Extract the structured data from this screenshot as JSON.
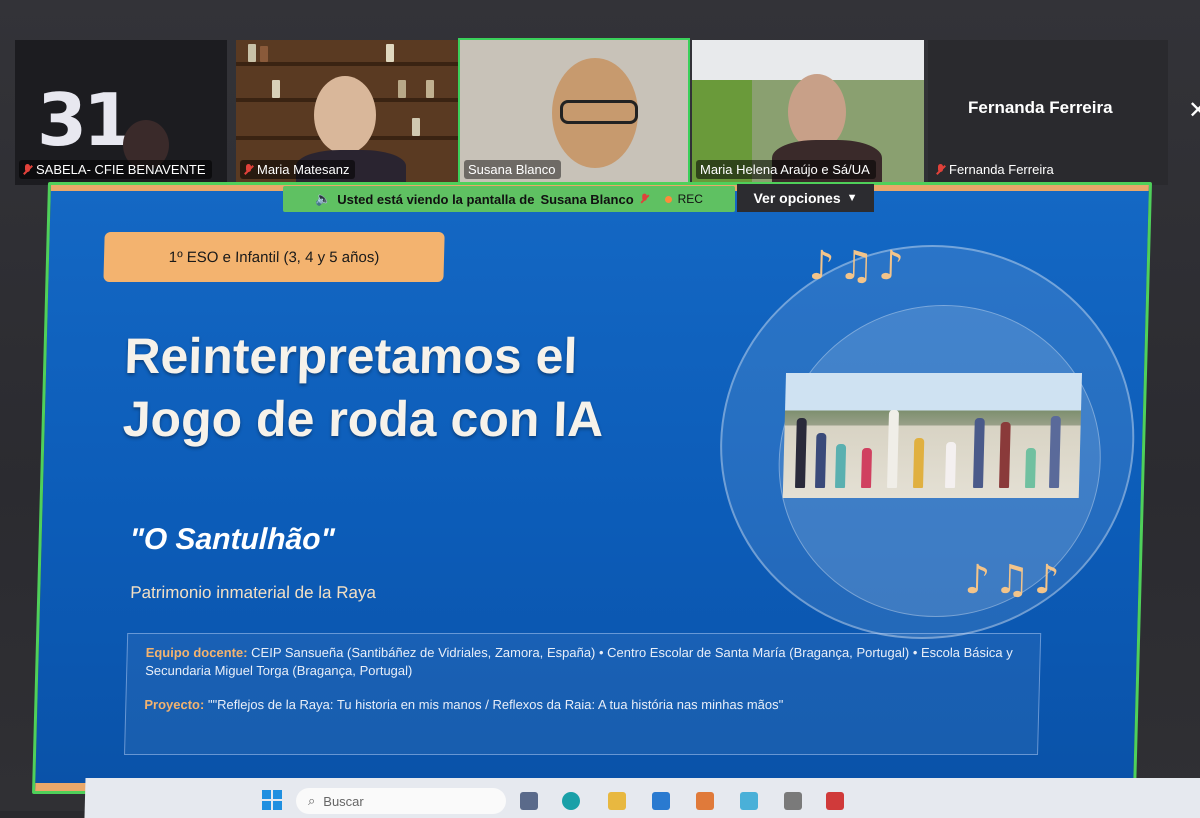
{
  "participants": [
    {
      "name": "SABELA- CFIE BENAVENTE",
      "muted": true,
      "overlay_text": "31"
    },
    {
      "name": "Maria Matesanz",
      "muted": true
    },
    {
      "name": "Susana Blanco",
      "muted": false,
      "active_speaker": true
    },
    {
      "name": "Maria Helena Araújo e Sá/UA",
      "muted": true
    },
    {
      "name": "Fernanda Ferreira",
      "muted": true,
      "title": "Fernanda Ferreira"
    }
  ],
  "share_banner": {
    "text_prefix": "Usted está viendo la pantalla de",
    "presenter": "Susana Blanco",
    "rec_label": "REC",
    "options_label": "Ver opciones"
  },
  "slide": {
    "tag": "1º ESO e Infantil (3, 4 y 5 años)",
    "title_line1": "Reinterpretamos el",
    "title_line2": "Jogo de roda con IA",
    "subtitle": "\"O Santulhão\"",
    "tagline": "Patrimonio inmaterial de la Raya",
    "notes_top": "♪♫♪",
    "notes_bottom": "♪♫♪",
    "team_label": "Equipo docente:",
    "team_text": "CEIP Sansueña (Santibáñez de Vidriales, Zamora, España)  •  Centro Escolar de Santa María (Bragança, Portugal)  •  Escola Básica y Secundaria Miguel Torga (Bragança, Portugal)",
    "project_label": "Proyecto:",
    "project_text": "\"\"Reflejos de la Raya: Tu historia en mis manos / Reflexos da Raia: A tua história nas minhas mãos\""
  },
  "taskbar": {
    "search_placeholder": "Buscar"
  },
  "colors": {
    "slide_blue": "#1468c4",
    "accent_orange": "#f3b36f",
    "share_green": "#5fc162"
  }
}
